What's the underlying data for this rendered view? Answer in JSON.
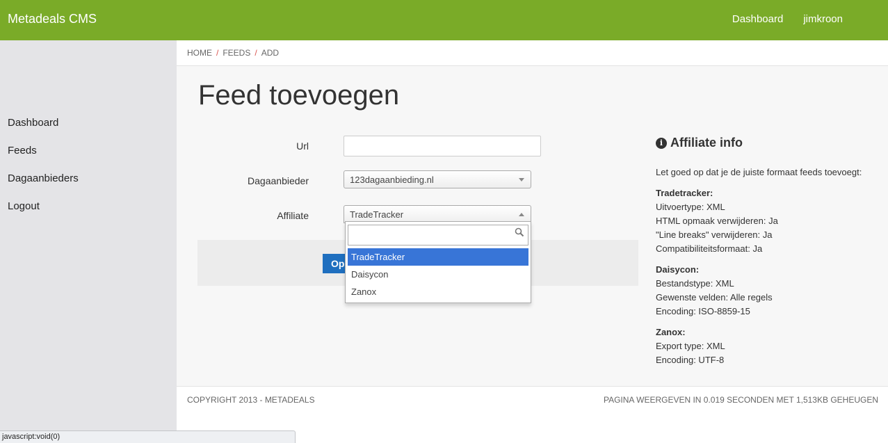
{
  "header": {
    "brand": "Metadeals CMS",
    "nav": [
      "Dashboard",
      "jimkroon"
    ]
  },
  "sidebar": {
    "items": [
      {
        "label": "Dashboard"
      },
      {
        "label": "Feeds"
      },
      {
        "label": "Dagaanbieders"
      },
      {
        "label": "Logout"
      }
    ]
  },
  "breadcrumb": {
    "items": [
      "HOME",
      "FEEDS",
      "ADD"
    ],
    "separator": "/"
  },
  "page": {
    "title": "Feed toevoegen"
  },
  "form": {
    "url_label": "Url",
    "url_value": "",
    "dagaanbieder_label": "Dagaanbieder",
    "dagaanbieder_value": "123dagaanbieding.nl",
    "affiliate_label": "Affiliate",
    "affiliate_value": "TradeTracker",
    "save_label": "Opslaan"
  },
  "dropdown": {
    "search_value": "",
    "options": [
      "TradeTracker",
      "Daisycon",
      "Zanox"
    ],
    "selected_index": 0
  },
  "info": {
    "title": "Affiliate info",
    "intro": "Let goed op dat je de juiste formaat feeds toevoegt:",
    "sections": [
      {
        "name": "Tradetracker:",
        "lines": [
          "Uitvoertype: XML",
          "HTML opmaak verwijderen: Ja",
          "\"Line breaks\" verwijderen: Ja",
          "Compatibiliteitsformaat: Ja"
        ]
      },
      {
        "name": "Daisycon:",
        "lines": [
          "Bestandstype: XML",
          "Gewenste velden: Alle regels",
          "Encoding: ISO-8859-15"
        ]
      },
      {
        "name": "Zanox:",
        "lines": [
          "Export type: XML",
          "Encoding: UTF-8"
        ]
      }
    ]
  },
  "footer": {
    "left": "COPYRIGHT 2013 - METADEALS",
    "right": "PAGINA WEERGEVEN IN 0.019 SECONDEN MET 1,513KB GEHEUGEN"
  },
  "statusbar": {
    "text": "javascript:void(0)"
  },
  "colors": {
    "brand_green": "#7aab28",
    "sidebar_bg": "#e4e4e7",
    "button_blue": "#1f6fbf",
    "selected_option": "#3875d7",
    "breadcrumb_sep": "#d9534f"
  }
}
